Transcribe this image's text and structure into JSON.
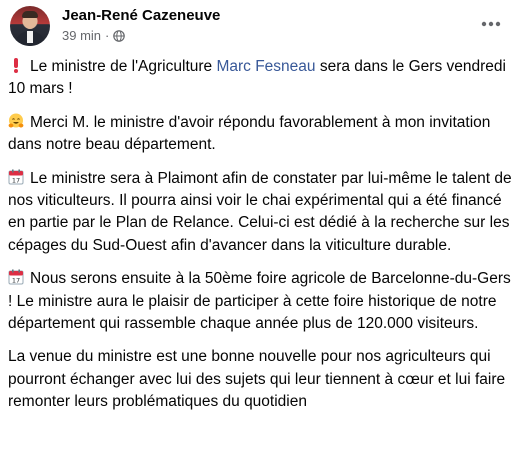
{
  "post": {
    "author": "Jean-René Cazeneuve",
    "time": "39 min",
    "separator": "·",
    "audience_icon": "globe-icon",
    "more_icon": "more-horizontal-icon"
  },
  "body": {
    "p1": {
      "icon": "exclamation-icon",
      "before": "Le ministre de l'Agriculture ",
      "mention": "Marc Fesneau",
      "after": " sera dans le Gers vendredi 10 mars !"
    },
    "p2": {
      "icon": "hugging-face-icon",
      "text": "Merci M. le ministre d'avoir répondu favorablement à mon invitation dans notre beau département."
    },
    "p3": {
      "icon": "calendar-icon",
      "text": "Le ministre sera à Plaimont afin de constater par lui-même le talent de nos viticulteurs. Il pourra ainsi voir le chai expérimental qui a été financé en partie par le Plan de Relance. Celui-ci est dédié à la recherche sur les cépages du Sud-Ouest afin d'avancer dans la viticulture durable."
    },
    "p4": {
      "icon": "calendar-icon",
      "text": "Nous serons ensuite à la 50ème foire agricole de Barcelonne-du-Gers ! Le ministre aura le plaisir de participer à cette foire historique de notre département qui rassemble chaque année plus de 120.000 visiteurs."
    },
    "p5": {
      "text": "La venue du ministre est une bonne nouvelle pour nos agriculteurs qui pourront échanger avec lui des sujets qui leur tiennent à cœur et lui faire remonter leurs problématiques du quotidien"
    }
  },
  "colors": {
    "link": "#385898",
    "secondary_text": "#65676b",
    "exclamation": "#dd2e44",
    "calendar_red": "#dd2e44"
  }
}
